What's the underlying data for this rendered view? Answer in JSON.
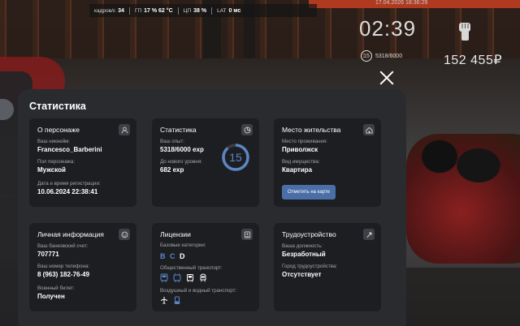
{
  "hud": {
    "fps_label": "кадров/с",
    "fps_value": "34",
    "gpu_label": "ГП",
    "gpu_value": "17 % 62 °C",
    "cpu_label": "ЦП",
    "cpu_value": "38 %",
    "lat_label": "LAT",
    "lat_value": "0 мс",
    "datetime": "17.04.2026 18:36:29",
    "clock": "02:39",
    "level": "15",
    "exp": "5318/6000",
    "money": "152 455₽"
  },
  "panel": {
    "title": "Статистика"
  },
  "person": {
    "title": "О персонаже",
    "nickname_label": "Ваш никнейм:",
    "nickname": "Francesco_Barberini",
    "gender_label": "Пол персонажа:",
    "gender": "Мужской",
    "reg_label": "Дата и время регистрации:",
    "reg_value": "10.06.2024 22:38:41"
  },
  "stats": {
    "title": "Статистика",
    "exp_label": "Ваш опыт:",
    "exp_value": "5318/6000 exp",
    "next_label": "До нового уровня:",
    "next_value": "682 exp",
    "level": "15",
    "level_progress": 0.886
  },
  "home": {
    "title": "Место жительства",
    "place_label": "Место проживания:",
    "place_value": "Приволжск",
    "property_label": "Вид имущества:",
    "property_value": "Квартира",
    "map_button": "Отметить на карте"
  },
  "info": {
    "title": "Личная информация",
    "bank_label": "Ваш банковский счет:",
    "bank_value": "707771",
    "phone_label": "Ваш номер телефона:",
    "phone_value": "8 (963) 182-76-49",
    "military_label": "Военный билет:",
    "military_value": "Получен"
  },
  "license": {
    "title": "Лицензии",
    "base_label": "Базовые категории:",
    "categories": [
      "B",
      "C",
      "D"
    ],
    "public_label": "Общественный транспорт:",
    "air_label": "Воздушный и водный транспорт:"
  },
  "job": {
    "title": "Трудоустройство",
    "position_label": "Ваша должность:",
    "position_value": "Безработный",
    "city_label": "Город трудоустройства:",
    "city_value": "Отсутствует"
  },
  "colors": {
    "accent": "#4a6fa8",
    "category_active": "#5b86c4",
    "category_highlight": "#ffffff"
  }
}
